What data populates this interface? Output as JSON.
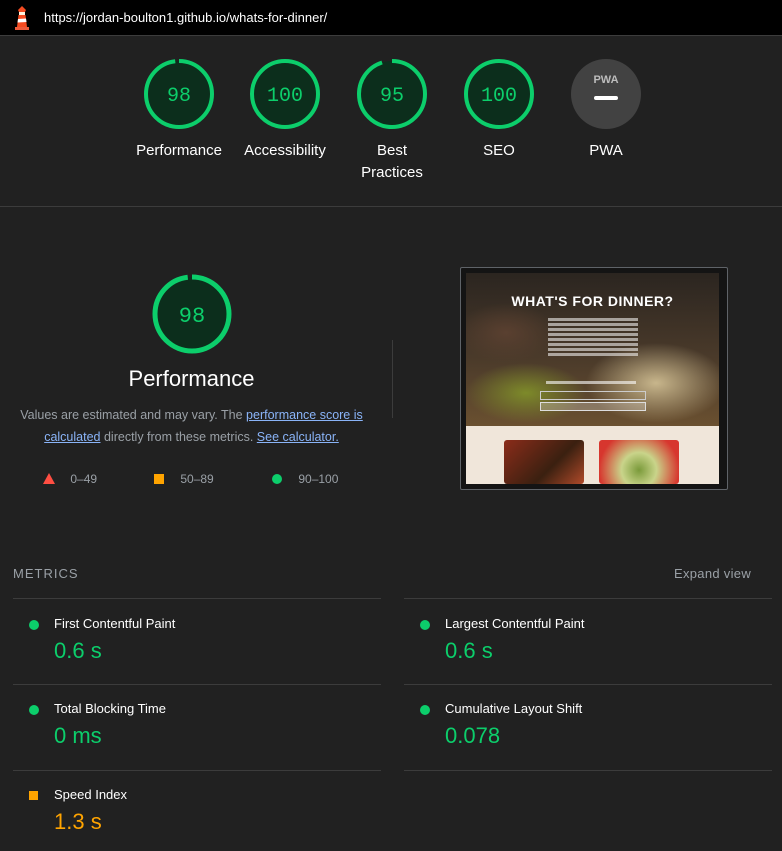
{
  "url": "https://jordan-boulton1.github.io/whats-for-dinner/",
  "colors": {
    "pass": "#0cce6b",
    "average": "#ffa400",
    "fail": "#ff4e42",
    "link": "#8ab4f8"
  },
  "categories": [
    {
      "score": "98",
      "label": "Performance"
    },
    {
      "score": "100",
      "label": "Accessibility"
    },
    {
      "score": "95",
      "label": "Best Practices",
      "label_line1": "Best",
      "label_line2": "Practices"
    },
    {
      "score": "100",
      "label": "SEO"
    },
    {
      "score": "",
      "label": "PWA",
      "badge": "PWA"
    }
  ],
  "performance": {
    "score": "98",
    "title": "Performance",
    "desc_prefix": "Values are estimated and may vary. The ",
    "link_score": "performance score is calculated",
    "desc_mid": " directly from these metrics. ",
    "link_calc": "See calculator."
  },
  "legend": [
    {
      "range": "0–49",
      "shape": "triangle-icon"
    },
    {
      "range": "50–89",
      "shape": "square-icon"
    },
    {
      "range": "90–100",
      "shape": "circle-icon"
    }
  ],
  "screenshot": {
    "title": "WHAT'S FOR DINNER?"
  },
  "metrics_header": "METRICS",
  "expand_view": "Expand view",
  "metrics": [
    {
      "name": "First Contentful Paint",
      "value": "0.6 s",
      "rating": "pass"
    },
    {
      "name": "Largest Contentful Paint",
      "value": "0.6 s",
      "rating": "pass"
    },
    {
      "name": "Total Blocking Time",
      "value": "0 ms",
      "rating": "pass"
    },
    {
      "name": "Cumulative Layout Shift",
      "value": "0.078",
      "rating": "pass"
    },
    {
      "name": "Speed Index",
      "value": "1.3 s",
      "rating": "average"
    }
  ]
}
